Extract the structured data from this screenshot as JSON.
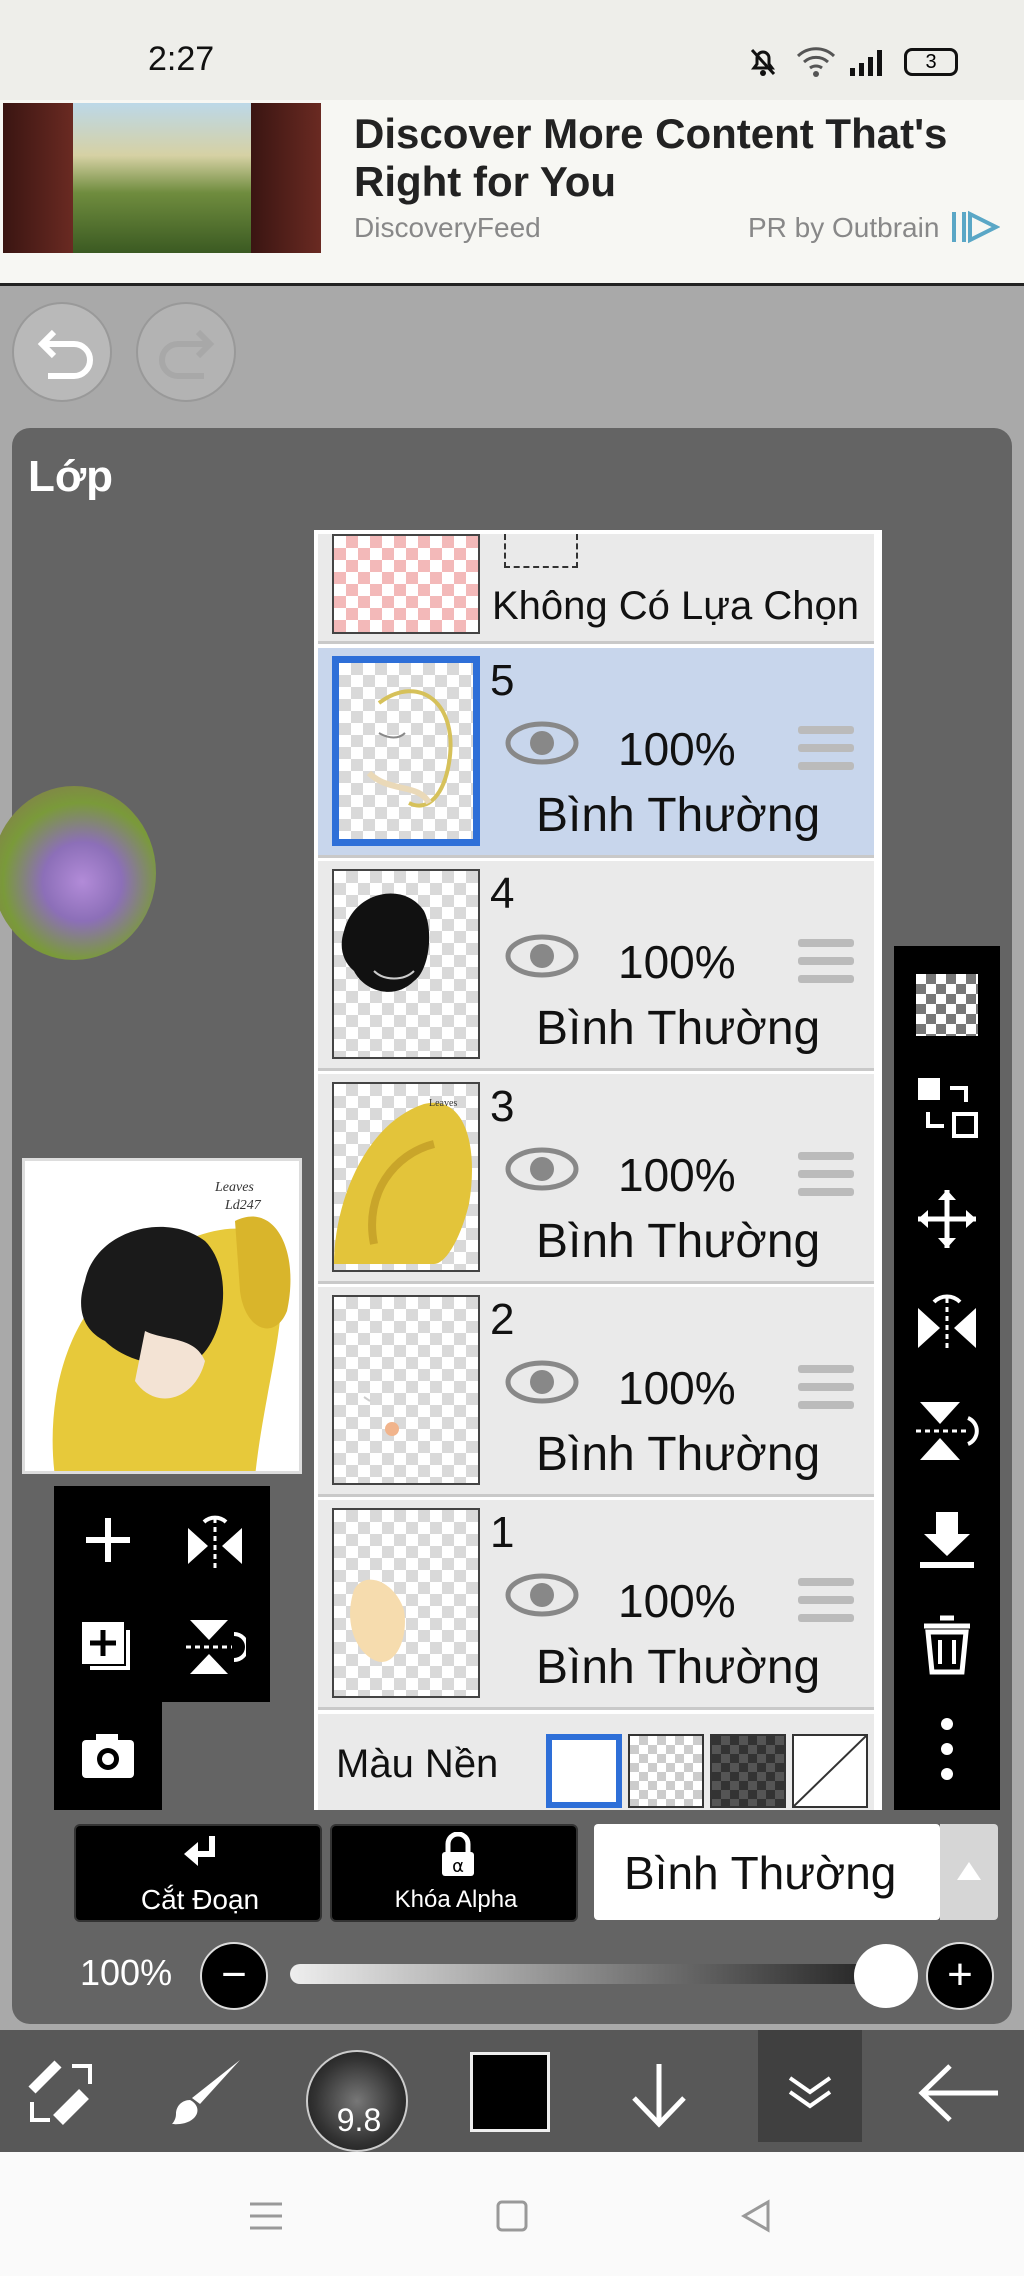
{
  "status_bar": {
    "time": "2:27",
    "battery": "3"
  },
  "ad": {
    "title": "Discover More Content That's Right for You",
    "source": "DiscoveryFeed",
    "sponsor": "PR by Outbrain"
  },
  "panel": {
    "title": "Lớp"
  },
  "selection_row": {
    "label": "Không Có Lựa Chọn"
  },
  "layers": [
    {
      "number": "5",
      "opacity": "100%",
      "mode": "Bình Thường",
      "selected": true
    },
    {
      "number": "4",
      "opacity": "100%",
      "mode": "Bình Thường",
      "selected": false
    },
    {
      "number": "3",
      "opacity": "100%",
      "mode": "Bình Thường",
      "selected": false
    },
    {
      "number": "2",
      "opacity": "100%",
      "mode": "Bình Thường",
      "selected": false
    },
    {
      "number": "1",
      "opacity": "100%",
      "mode": "Bình Thường",
      "selected": false
    }
  ],
  "background": {
    "label": "Màu Nền"
  },
  "buttons": {
    "clip": "Cắt Đoạn",
    "alpha_lock": "Khóa Alpha"
  },
  "blend_mode": "Bình Thường",
  "opacity_label": "100%",
  "brush_size": "9.8",
  "colors": {
    "accent": "#2e6fd8",
    "selected_row": "#c8d6ec",
    "current_color": "#000000"
  }
}
